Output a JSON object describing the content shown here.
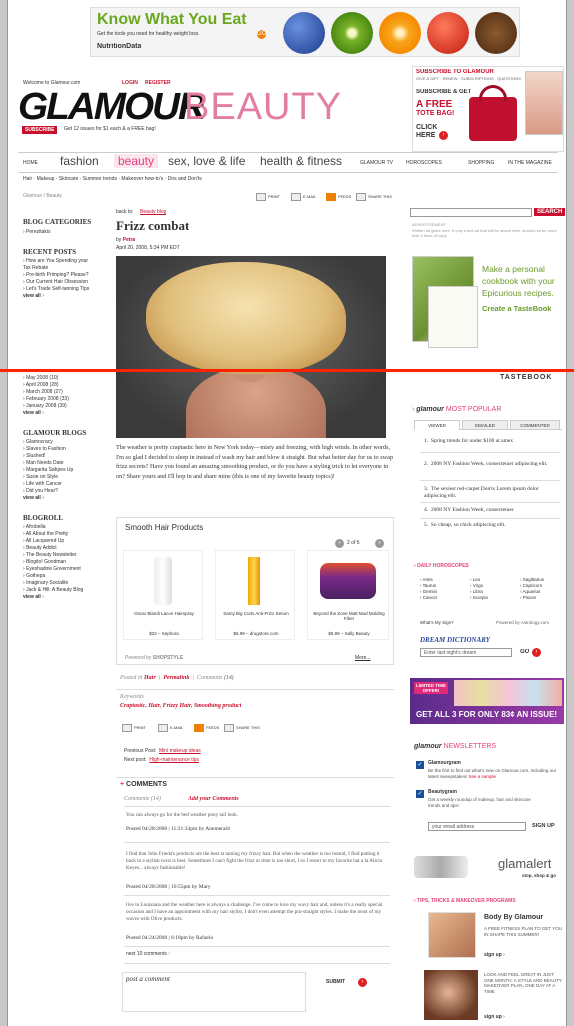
{
  "banner": {
    "title": "Know What You Eat",
    "sub": "Get the tools you need for healthy weight loss.",
    "go": "GO",
    "brand": "NutritionData"
  },
  "header": {
    "welcome": "Welcome to Glamour.com",
    "login": "LOGIN",
    "register": "REGISTER",
    "logo": "GLAMOUR",
    "section": "BEAUTY",
    "subscribe_btn": "SUBSCRIBE",
    "subscribe_text": "Get 12 issues for $1 each & a FREE bag!"
  },
  "promo": {
    "title": "SUBSCRIBE TO GLAMOUR",
    "links": "GIVE A GIFT · RENEW · SUBSCRIPTIONS · QUESTIONS",
    "line1": "SUBSCRIBE & GET",
    "line2": "A FREE",
    "line3": "TOTE BAG!",
    "click": "CLICK",
    "here": "HERE"
  },
  "nav": {
    "home": "HOME",
    "items": [
      "fashion",
      "beauty",
      "sex, love & life",
      "health & fitness"
    ],
    "small": [
      "GLAMOUR TV",
      "HOROSCOPES",
      "SHOPPING",
      "IN THE MAGAZINE"
    ],
    "sub": [
      "Hair",
      "Makeup",
      "Skincare",
      "Summer trends",
      "Makeover how-to's",
      "Dos and Don'ts"
    ]
  },
  "breadcrumb": "Glamour / Beauty",
  "tools": [
    "PRINT",
    "E-MAIL",
    "FEEDS",
    "SHARE THIS"
  ],
  "sidebar": {
    "blog_categories": "BLOG CATEGORIES",
    "categories": [
      "Perezitakis"
    ],
    "recent_posts": "RECENT POSTS",
    "posts": [
      "How are You Spending your Tax Rebate",
      "Pre-birth Primping? Please?",
      "Our Current Hair Obsession",
      "Let's Trade Self-tanning Tips"
    ],
    "view_all": "view all",
    "archive": [
      "May 2008 (10)",
      "April 2008 (28)",
      "March 2008 (27)",
      "February 2008 (33)",
      "January 2008 (39)"
    ],
    "glamour_blogs": "GLAMOUR BLOGS",
    "blogs": [
      "Glamocracy",
      "Slaves to Fashion",
      "Slushed!",
      "Man Needs Date",
      "Margarita Sahpes Up",
      "Susie on Style",
      "Life with Cancer",
      "Did you Hear?"
    ],
    "blogroll": "BLOGROLL",
    "blogroll_items": [
      "Afrobella",
      "All About the Pretty",
      "All Lacquered Up",
      "Beauty Addict",
      "The Beauty Newsletter",
      "Blogito! Goodman",
      "Eyeshadow Government",
      "Gothepa",
      "Imaginary Socialite",
      "Jack & Hill: A Beauty Blog"
    ]
  },
  "article": {
    "back": "back to:",
    "back_link": "Beauty blog",
    "title": "Frizz combat",
    "by": "by",
    "author": "Petra",
    "date": "April 20, 2008, 5:34 PM EDT",
    "body": "The weather is pretty craptastic here in New York today—misty and freezing, with high winds. In other words, I'm so glad I decided to sleep in instead of wash my hair and blow it straight. But what better day for us to swap frizz secrets? Have you found an amazing smoothing product, or do you have a styling trick to let everyone in on? Share yours and I'll hop in and share mine (this is one of my favorite beauty topics)!",
    "products_title": "Smooth Hair Products",
    "products_page": "2 of 5",
    "products": [
      {
        "name": "Oscar Blandi Lacon Hairspray",
        "price": "$22 – Sephora"
      },
      {
        "name": "Samy Big Curls Anti-Frizz Serum",
        "price": "$6.99 – drugstore.com"
      },
      {
        "name": "Beyond the Zone Matt Mud Molding Fiber",
        "price": "$6.99 – Sally Beauty"
      }
    ],
    "powered": "Powered by",
    "powered_brand": "SHOPSTYLE",
    "more": "More...",
    "posted_in": "Posted in",
    "cat": "Hair",
    "permalink": "Permalink",
    "comments_label": "Comments",
    "comments_count": "(14)",
    "keywords_label": "Keywords",
    "keywords": "Craptastic, Hair, Frizzy Hair, Smoothing product",
    "prev_label": "Previous Post",
    "prev_link": "Mini makeup ideas",
    "next_label": "Next post",
    "next_link": "High-maintenance tips"
  },
  "comments": {
    "title": "COMMENTS",
    "count": "Comments (14)",
    "add": "Add your Comments",
    "items": [
      {
        "text": "You can always go for the bed weather pony tail look.",
        "meta": "Posted 04/28/2008 | 11:21:33pm by Anemerald"
      },
      {
        "text": "I find that John Frieda's products are the best at taming my frizzy hair. But when the weather is too humid, I find putting it back in a stylish twist is best. Sometimes I can't fight the frizz or time is too short, I so I resort to my favorite hat a la Alicia Keyes... always fashionable!",
        "meta": "Posted 04/28/2008 | 10:55pm by Mary"
      },
      {
        "text": "live in Louisiana and the weather here is always a challenge. I've come to love my wavy hair and, unless it's a really special occasion and I have an appointment with my hair stylist, I don't even attempt the pin-straight styles. I make the most of my waves with Olive products.",
        "meta": "Posted 04/24/2008 | 6:18pm by Rafaela"
      }
    ],
    "next": "next 10 comments",
    "post_label": "post a comment",
    "submit": "SUBMIT"
  },
  "right": {
    "search_btn": "SEARCH",
    "ad_label": "ADVERTISEMENT",
    "ad_note": "Written ad gives here. If only a text ad that will be above here, should not be more than 2 lines of copy.",
    "tastebook": {
      "line1": "Make a personal",
      "line2": "cookbook with your",
      "line3": "Epicurious recipes.",
      "cta": "Create a TasteBook",
      "logo": "TASTEBOOK"
    },
    "popular_brand": "glamour",
    "popular_title": "MOST POPULAR",
    "tabs": [
      "VIEWED",
      "EMAILED",
      "COMMENTED"
    ],
    "popular": [
      "Spring trends for under $100 at amex",
      "2008 NY Fashion Week, consectetuer adipiscing elit.",
      "The sexiest red-carpet Don'ts Lorem ipsum dolor adipiscing elit.",
      "2008 NY Fashion Week, consectetuer",
      "So cheap, so chick adipiscing elit."
    ],
    "horoscopes_title": "DAILY HOROSCOPES",
    "signs": [
      [
        "Aries",
        "Leo",
        "Sagittarius"
      ],
      [
        "Taurus",
        "Virgo",
        "Capricorn"
      ],
      [
        "Gemini",
        "Libra",
        "Aquarius"
      ],
      [
        "Cancer",
        "Scorpio",
        "Pisces"
      ]
    ],
    "whats_sign": "What's My Sign?",
    "powered_astro": "Powered by Astrology.com",
    "dream_title": "DREAM DICTIONARY",
    "dream_placeholder": "Enter last night's dream",
    "dream_go": "GO",
    "offer_banner": "GET ALL 3 FOR ONLY 83¢ AN ISSUE!",
    "offer_tag": "LIMITED TIME OFFER!",
    "news_brand": "glamour",
    "news_title": "NEWSLETTERS",
    "newsletters": [
      {
        "name": "Glamourgram",
        "desc": "Be the first to find out what's new on Glamour.com, including our latest sweepstakes!",
        "link": "See a sample"
      },
      {
        "name": "Beautygram",
        "desc": "Get a weekly roundup of makeup, hair and skincare trends and tips!"
      }
    ],
    "email_placeholder": "your email address",
    "signup": "SIGN UP",
    "glamalert": "glamalert",
    "glamalert_sub": "stop, shop & go",
    "tips_title": "TIPS, TRICKS & MAKEOVER PROGRAMS",
    "tip1_title": "Body By Glamour",
    "tip1_text": "A FREE FITNESS PLAN TO GET YOU IN SHAPE THIS SUMMER!",
    "tip1_cta": "sign up",
    "tip2_text": "LOOK AND FEEL GREAT IN JUST ONE MONTH: A STYLE AND BEAUTY MAKEOVER PLAN, ONE DAY AT A TIME",
    "tip2_cta": "sign up"
  },
  "colors": {
    "accent": "#e3417a",
    "red_line": "#ff2200",
    "brand_red": "#c8102e"
  }
}
